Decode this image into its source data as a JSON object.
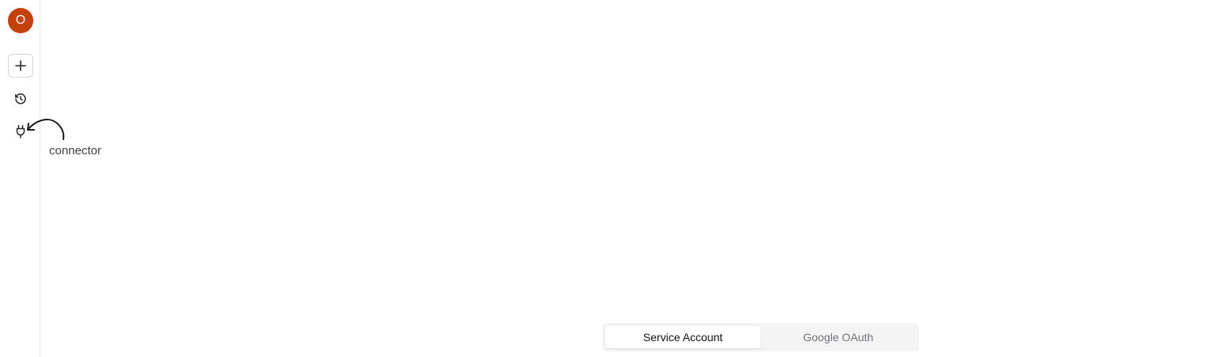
{
  "sidebar": {
    "avatar_initial": "O",
    "icons": {
      "new": "plus-icon",
      "history": "history-icon",
      "connector": "plug-icon"
    }
  },
  "hint": {
    "label": "connector"
  },
  "auth_toggle": {
    "options": [
      "Service Account",
      "Google OAuth"
    ],
    "selected": "Service Account"
  },
  "colors": {
    "avatar_bg": "#c2410c",
    "toggle_bg": "#f4f4f5"
  }
}
